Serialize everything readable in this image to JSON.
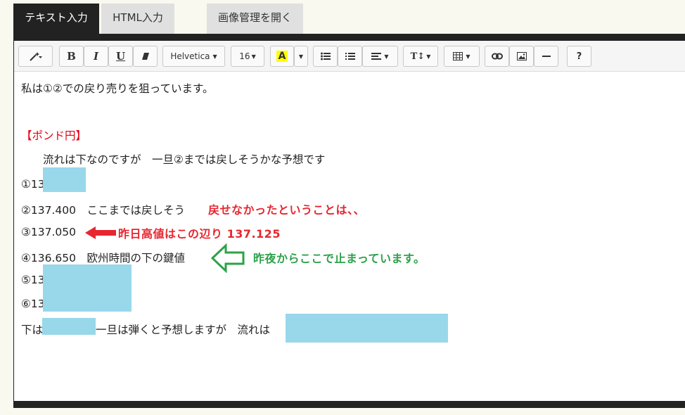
{
  "tabs": {
    "text": "テキスト入力",
    "html": "HTML入力",
    "open_images": "画像管理を開く"
  },
  "toolbar": {
    "magic_icon": "magic-wand-icon",
    "bold": "B",
    "italic": "I",
    "underline": "U",
    "eraser_icon": "eraser-icon",
    "font_name": "Helvetica",
    "font_size": "16",
    "font_color": "A",
    "ul_icon": "unordered-list-icon",
    "ol_icon": "ordered-list-icon",
    "align_icon": "align-icon",
    "line_height": "T↕",
    "table_icon": "table-icon",
    "link_icon": "link-icon",
    "picture_icon": "picture-icon",
    "hr_icon": "horizontal-rule-icon",
    "help": "?"
  },
  "content": {
    "line1": "私は①②での戻り売りを狙っています。",
    "heading": "【ポンド円】",
    "line3": "　　流れは下なのですが　一旦②までは戻しそうかな予想です",
    "item1": "①13",
    "item2": "②137.400　ここまでは戻しそう",
    "item3": "③137.050",
    "item4": "④136.650　欧州時間の下の鍵値",
    "item5": "⑤13",
    "item6": "⑥13",
    "line_last_a": "下は",
    "line_last_b": "一旦は弾くと予想しますが　流れは"
  },
  "annotations": {
    "a1": "戻せなかったということは、、",
    "a2": "昨日高値はこの辺り 137.125",
    "a3": "昨夜からここで止まっています。"
  },
  "colors": {
    "red": "#e8262f",
    "green": "#2ca24a",
    "highlight": "#98d8ea",
    "frame": "#222222"
  }
}
